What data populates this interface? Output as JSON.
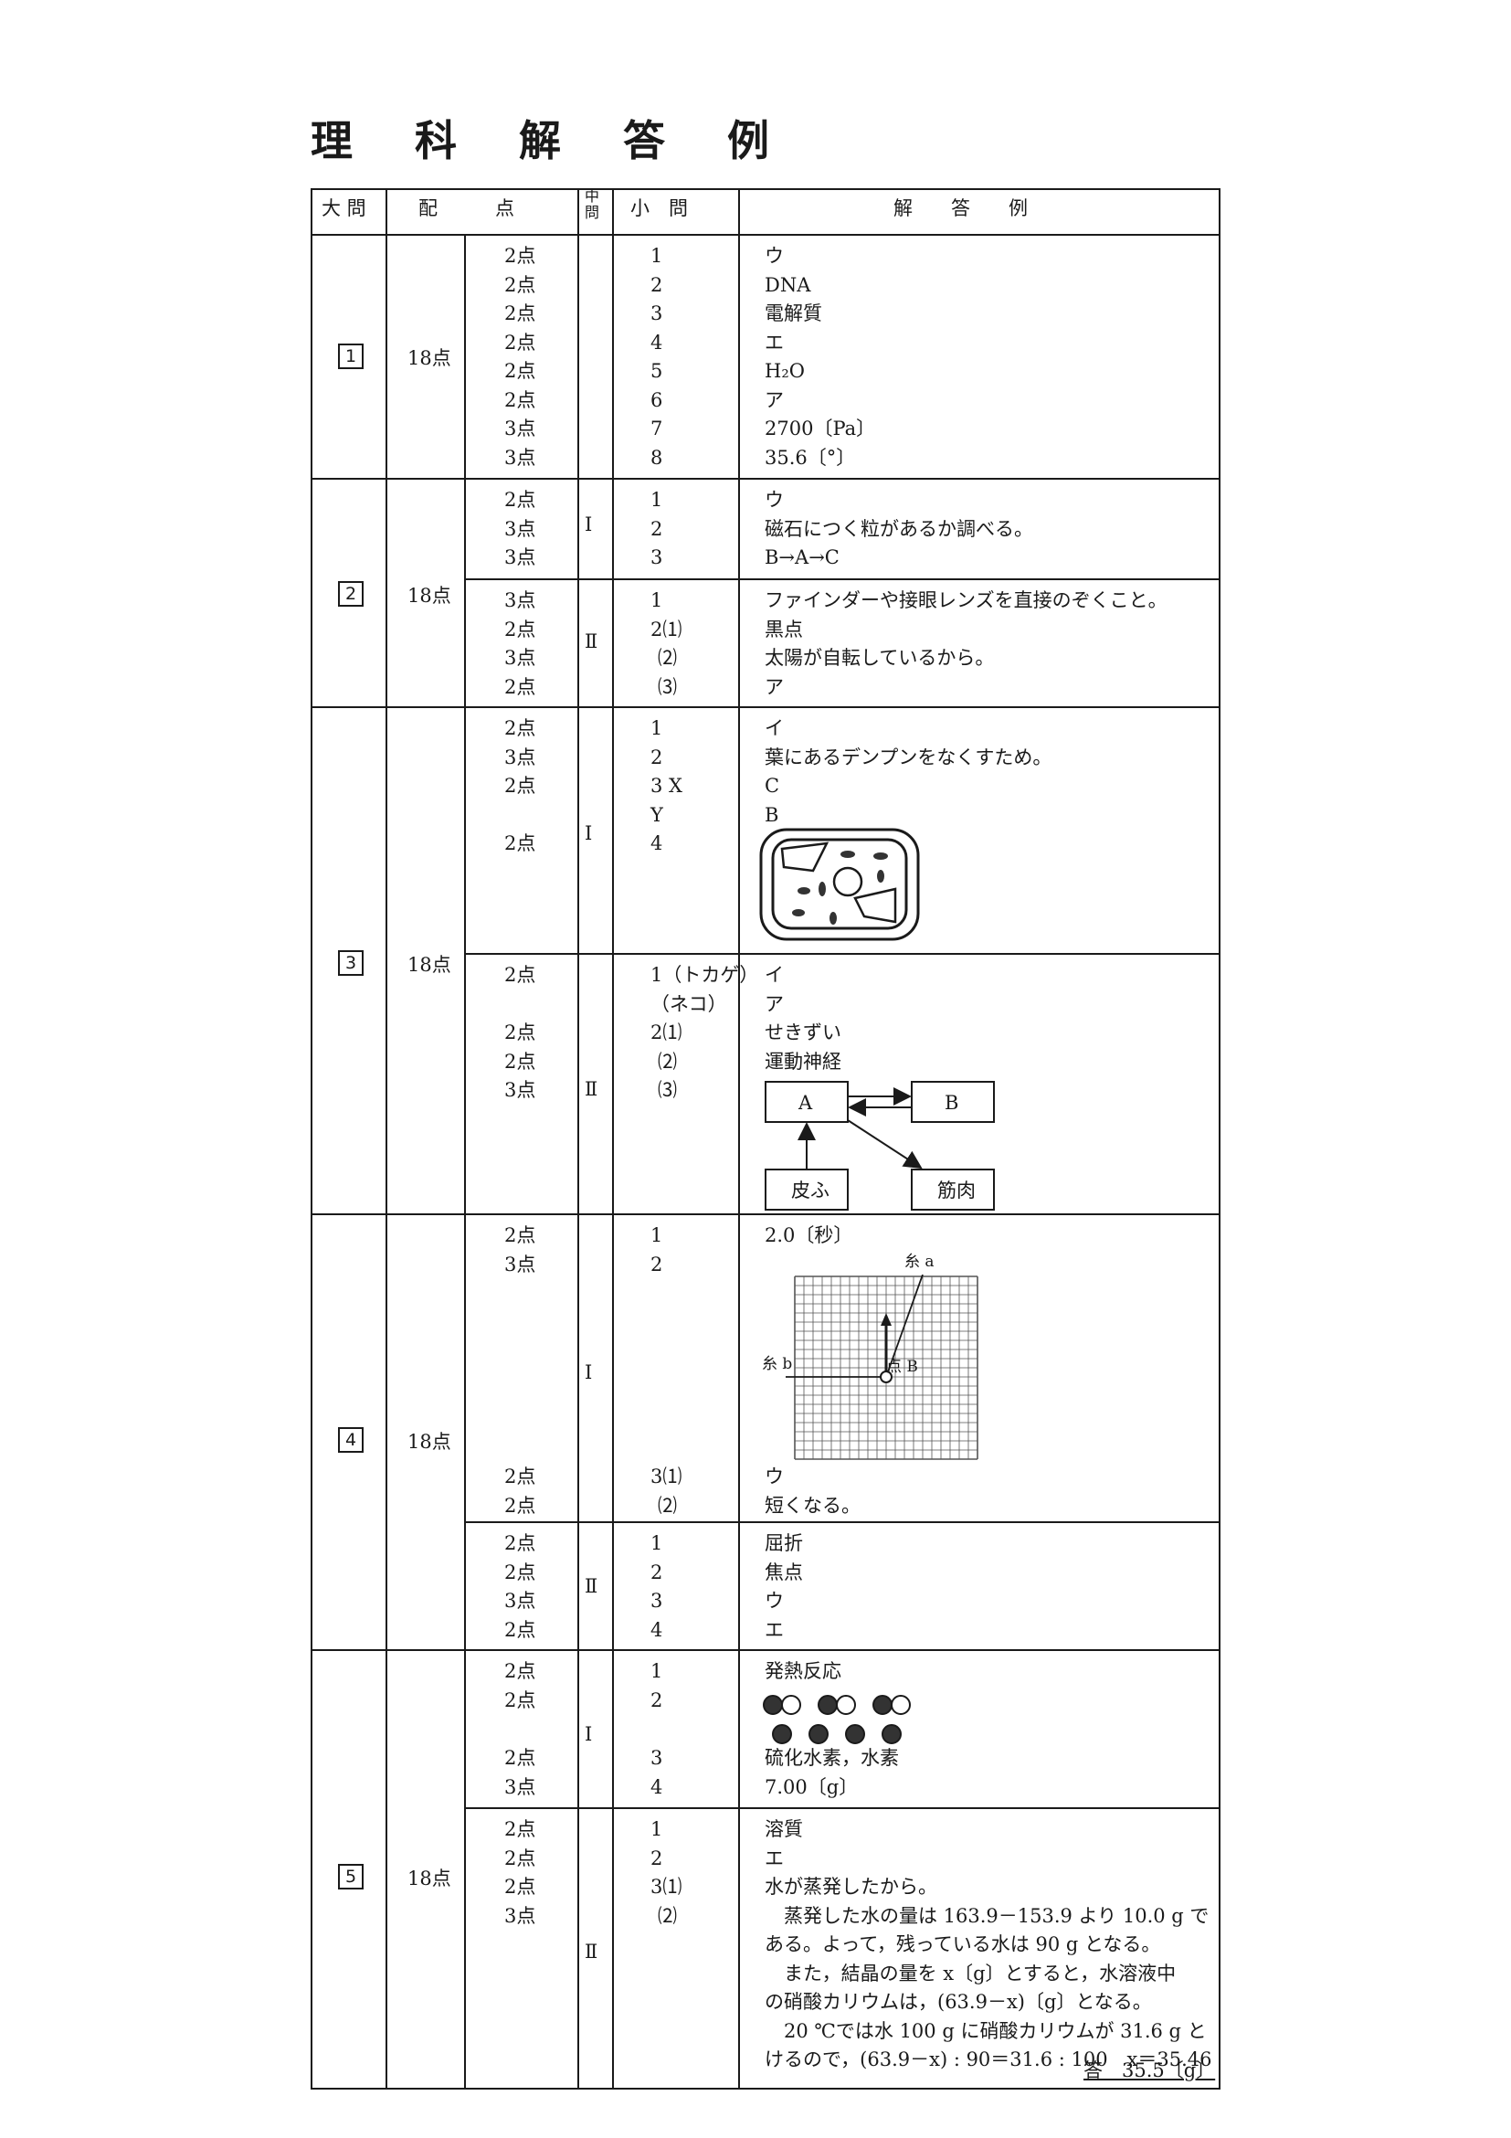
{
  "title": "理 科 解 答 例",
  "header": {
    "dai": "大 問",
    "haiten": "配　　　点",
    "chu": "中問",
    "sho": "小　問",
    "kaito": "解　　答　　例"
  },
  "q1": {
    "num": "1",
    "total": "18点",
    "rows": [
      {
        "pts": "2点",
        "q": "1",
        "a": "ウ"
      },
      {
        "pts": "2点",
        "q": "2",
        "a": "DNA"
      },
      {
        "pts": "2点",
        "q": "3",
        "a": "電解質"
      },
      {
        "pts": "2点",
        "q": "4",
        "a": "エ"
      },
      {
        "pts": "2点",
        "q": "5",
        "a": "H₂O"
      },
      {
        "pts": "2点",
        "q": "6",
        "a": "ア"
      },
      {
        "pts": "3点",
        "q": "7",
        "a": "2700〔Pa〕"
      },
      {
        "pts": "3点",
        "q": "8",
        "a": "35.6〔°〕"
      }
    ]
  },
  "q2": {
    "num": "2",
    "total": "18点",
    "I": {
      "label": "Ⅰ",
      "rows": [
        {
          "pts": "2点",
          "q": "1",
          "a": "ウ"
        },
        {
          "pts": "3点",
          "q": "2",
          "a": "磁石につく粒があるか調べる。"
        },
        {
          "pts": "3点",
          "q": "3",
          "a": "B→A→C"
        }
      ]
    },
    "II": {
      "label": "Ⅱ",
      "rows": [
        {
          "pts": "3点",
          "q": "1",
          "a": "ファインダーや接眼レンズを直接のぞくこと。"
        },
        {
          "pts": "2点",
          "q": "2⑴",
          "a": "黒点"
        },
        {
          "pts": "3点",
          "q": "⑵",
          "a": "太陽が自転しているから。"
        },
        {
          "pts": "2点",
          "q": "⑶",
          "a": "ア"
        }
      ]
    }
  },
  "q3": {
    "num": "3",
    "total": "18点",
    "I": {
      "label": "Ⅰ",
      "rows": [
        {
          "pts": "2点",
          "q": "1",
          "a": "イ"
        },
        {
          "pts": "3点",
          "q": "2",
          "a": "葉にあるデンプンをなくすため。"
        },
        {
          "pts": "2点",
          "q": "3 X",
          "a": "C"
        },
        {
          "pts": "",
          "q": "Y",
          "a": "B"
        },
        {
          "pts": "2点",
          "q": "4",
          "a": ""
        }
      ]
    },
    "II": {
      "label": "Ⅱ",
      "rows": [
        {
          "pts": "2点",
          "q": "1（トカゲ）",
          "a": "イ"
        },
        {
          "pts": "",
          "q": "（ネコ）",
          "a": "ア"
        },
        {
          "pts": "2点",
          "q": "2⑴",
          "a": "せきずい"
        },
        {
          "pts": "2点",
          "q": "⑵",
          "a": "運動神経"
        },
        {
          "pts": "3点",
          "q": "⑶",
          "a": ""
        }
      ],
      "diagram": {
        "a": "A",
        "b": "B",
        "skin": "皮ふ",
        "muscle": "筋肉"
      }
    }
  },
  "q4": {
    "num": "4",
    "total": "18点",
    "I": {
      "label": "Ⅰ",
      "rows": [
        {
          "pts": "2点",
          "q": "1",
          "a": "2.0〔秒〕"
        },
        {
          "pts": "3点",
          "q": "2",
          "a": ""
        }
      ],
      "rows2": [
        {
          "pts": "2点",
          "q": "3⑴",
          "a": "ウ"
        },
        {
          "pts": "2点",
          "q": "⑵",
          "a": "短くなる。"
        }
      ],
      "grid": {
        "ito_a": "糸 a",
        "ito_b": "糸 b",
        "point_b": "点 B"
      }
    },
    "II": {
      "label": "Ⅱ",
      "rows": [
        {
          "pts": "2点",
          "q": "1",
          "a": "屈折"
        },
        {
          "pts": "2点",
          "q": "2",
          "a": "焦点"
        },
        {
          "pts": "3点",
          "q": "3",
          "a": "ウ"
        },
        {
          "pts": "2点",
          "q": "4",
          "a": "エ"
        }
      ]
    }
  },
  "q5": {
    "num": "5",
    "total": "18点",
    "I": {
      "label": "Ⅰ",
      "rows": [
        {
          "pts": "2点",
          "q": "1",
          "a": "発熱反応"
        },
        {
          "pts": "2点",
          "q": "2",
          "a": ""
        },
        {
          "pts": "2点",
          "q": "3",
          "a": "硫化水素，水素"
        },
        {
          "pts": "3点",
          "q": "4",
          "a": "7.00〔g〕"
        }
      ]
    },
    "II": {
      "label": "Ⅱ",
      "rows": [
        {
          "pts": "2点",
          "q": "1",
          "a": "溶質"
        },
        {
          "pts": "2点",
          "q": "2",
          "a": "エ"
        },
        {
          "pts": "2点",
          "q": "3⑴",
          "a": "水が蒸発したから。"
        },
        {
          "pts": "3点",
          "q": "⑵",
          "a": "　蒸発した水の量は 163.9－153.9 より 10.0 g で"
        }
      ],
      "calc": [
        "ある。よって，残っている水は 90 g となる。",
        "　また，結晶の量を x〔g〕とすると，水溶液中",
        "の硝酸カリウムは，(63.9－x)〔g〕となる。",
        "　20 ℃では水 100 g に硝酸カリウムが 31.6 g と",
        "けるので，(63.9－x) : 90＝31.6 : 100　x＝35.46"
      ],
      "final": "答　35.5〔g〕"
    }
  }
}
